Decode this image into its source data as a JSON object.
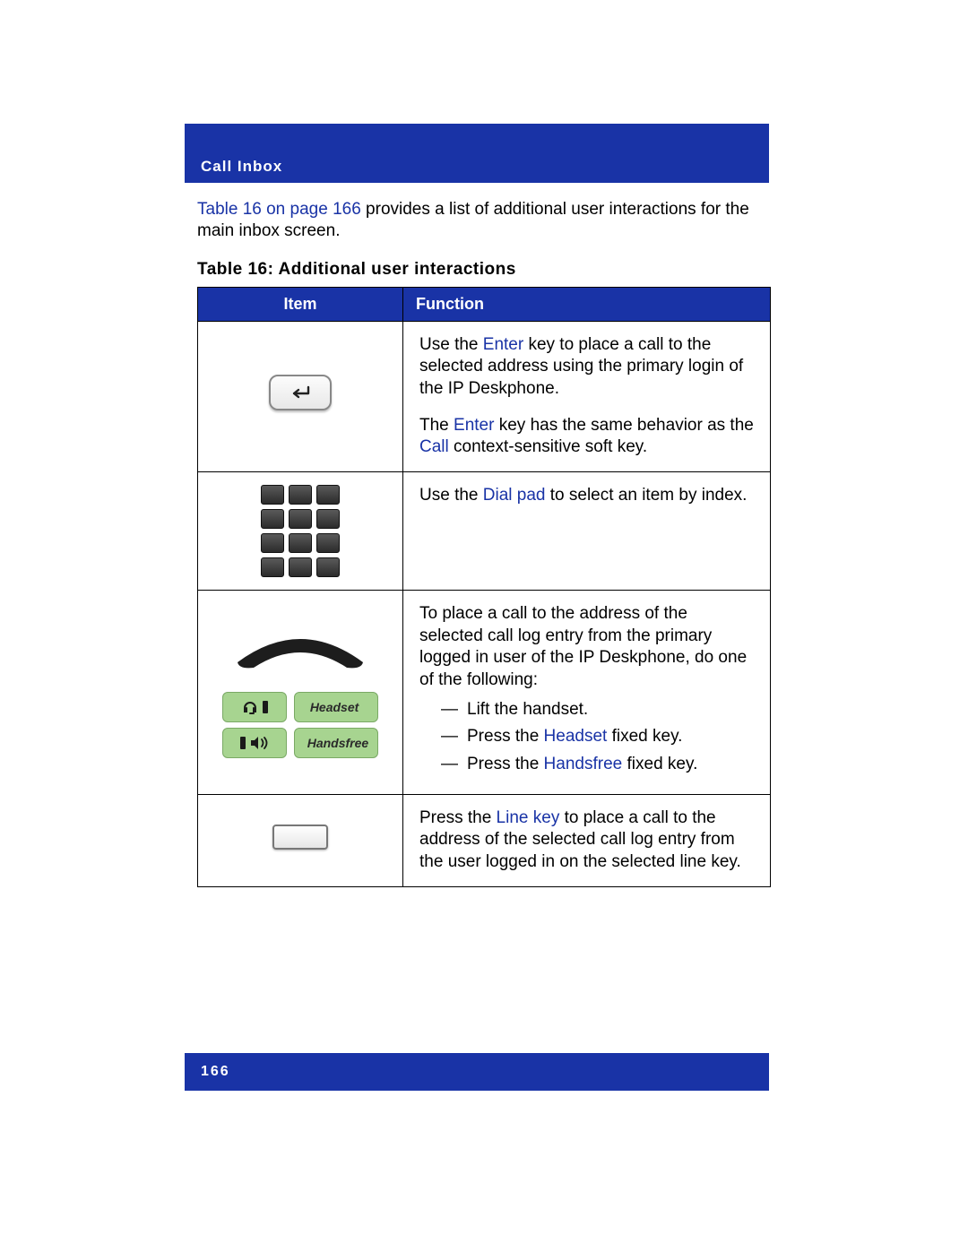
{
  "header": {
    "title": "Call Inbox"
  },
  "intro": {
    "link": "Table 16 on page 166",
    "rest": " provides a list of additional user interactions for the main inbox screen."
  },
  "table": {
    "caption": "Table 16: Additional user interactions",
    "head": {
      "item": "Item",
      "func": "Function"
    },
    "rows": {
      "r1": {
        "p1a": "Use the ",
        "p1b": "Enter",
        "p1c": " key to place a call to the selected address using the primary login of the IP Deskphone.",
        "p2a": "The ",
        "p2b": "Enter",
        "p2c": " key has the same behavior as the ",
        "p2d": "Call",
        "p2e": " context-sensitive soft key."
      },
      "r2": {
        "p1a": "Use the ",
        "p1b": "Dial pad",
        "p1c": " to select an item by index."
      },
      "r3": {
        "p1": "To place a call to the address of the selected call log entry from the primary logged in user of the IP Deskphone, do one of the following:",
        "li1": "Lift the handset.",
        "li2a": "Press the ",
        "li2b": "Headset",
        "li2c": " fixed key.",
        "li3a": "Press the ",
        "li3b": "Handsfree",
        "li3c": " fixed key.",
        "btn_headset": "Headset",
        "btn_handsfree": "Handsfree"
      },
      "r4": {
        "p1a": "Press the ",
        "p1b": "Line key",
        "p1c": " to place a call to the address of the selected call log entry from the user logged in on the selected line key."
      }
    }
  },
  "footer": {
    "page": "166"
  }
}
